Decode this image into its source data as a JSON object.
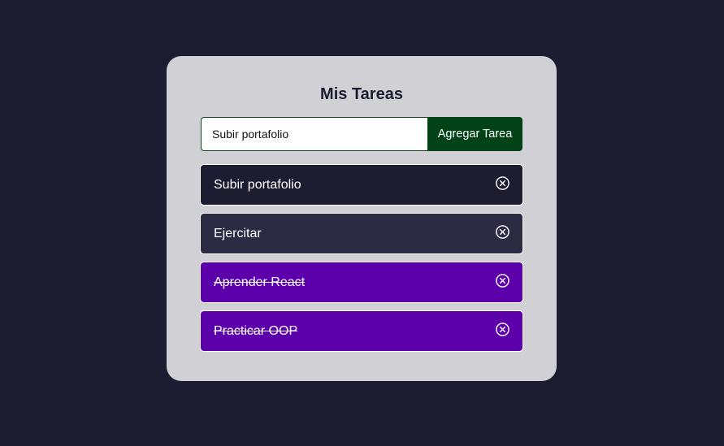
{
  "app": {
    "title": "Mis Tareas",
    "input": {
      "value": "Subir portafolio",
      "placeholder": ""
    },
    "add_button_label": "Agregar Tarea",
    "tasks": [
      {
        "text": "Subir portafolio",
        "completed": false,
        "icon": "close-circle-icon"
      },
      {
        "text": "Ejercitar",
        "completed": false,
        "icon": "close-circle-icon"
      },
      {
        "text": "Aprender React",
        "completed": true,
        "icon": "close-circle-icon"
      },
      {
        "text": "Practicar OOP",
        "completed": true,
        "icon": "close-circle-icon"
      }
    ]
  },
  "colors": {
    "page_background": "#1c1d31",
    "card_background": "#d1d0d5",
    "button_background": "#014317",
    "task_pending_1": "#1c1d31",
    "task_pending_2": "#2b2b43",
    "task_completed": "#5b00aa"
  }
}
